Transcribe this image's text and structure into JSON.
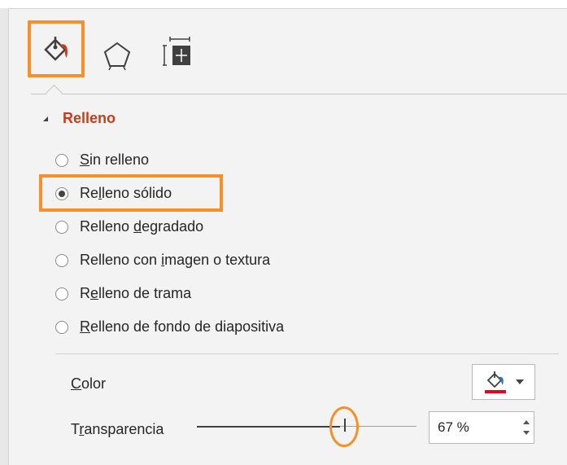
{
  "tabs": [
    {
      "icon": "fill-bucket-icon",
      "selected": true
    },
    {
      "icon": "pentagon-shape-icon",
      "selected": false
    },
    {
      "icon": "size-properties-icon",
      "selected": false
    }
  ],
  "section": {
    "title": "Relleno",
    "collapse_icon": "collapse-triangle-icon"
  },
  "fill_options": [
    {
      "pre": "",
      "key": "S",
      "post": "in relleno",
      "selected": false
    },
    {
      "pre": "Re",
      "key": "l",
      "post": "leno sólido",
      "selected": true
    },
    {
      "pre": "Relleno ",
      "key": "d",
      "post": "egradado",
      "selected": false
    },
    {
      "pre": "Relleno con ",
      "key": "i",
      "post": "magen o textura",
      "selected": false
    },
    {
      "pre": "R",
      "key": "e",
      "post": "lleno de trama",
      "selected": false
    },
    {
      "pre": "",
      "key": "R",
      "post": "elleno de fondo de diapositiva",
      "selected": false
    }
  ],
  "color": {
    "label_key": "C",
    "label_rest": "olor",
    "button_icon": "paint-bucket-icon",
    "swatch": "#e8001c",
    "dropdown_icon": "chevron-down-icon"
  },
  "transparency": {
    "label_pre": "T",
    "label_key": "r",
    "label_rest": "ansparencia",
    "value": "67 %",
    "slider_fraction": 0.67
  },
  "colors": {
    "accent_orange": "#f7902a",
    "section_title": "#c43e1c"
  }
}
